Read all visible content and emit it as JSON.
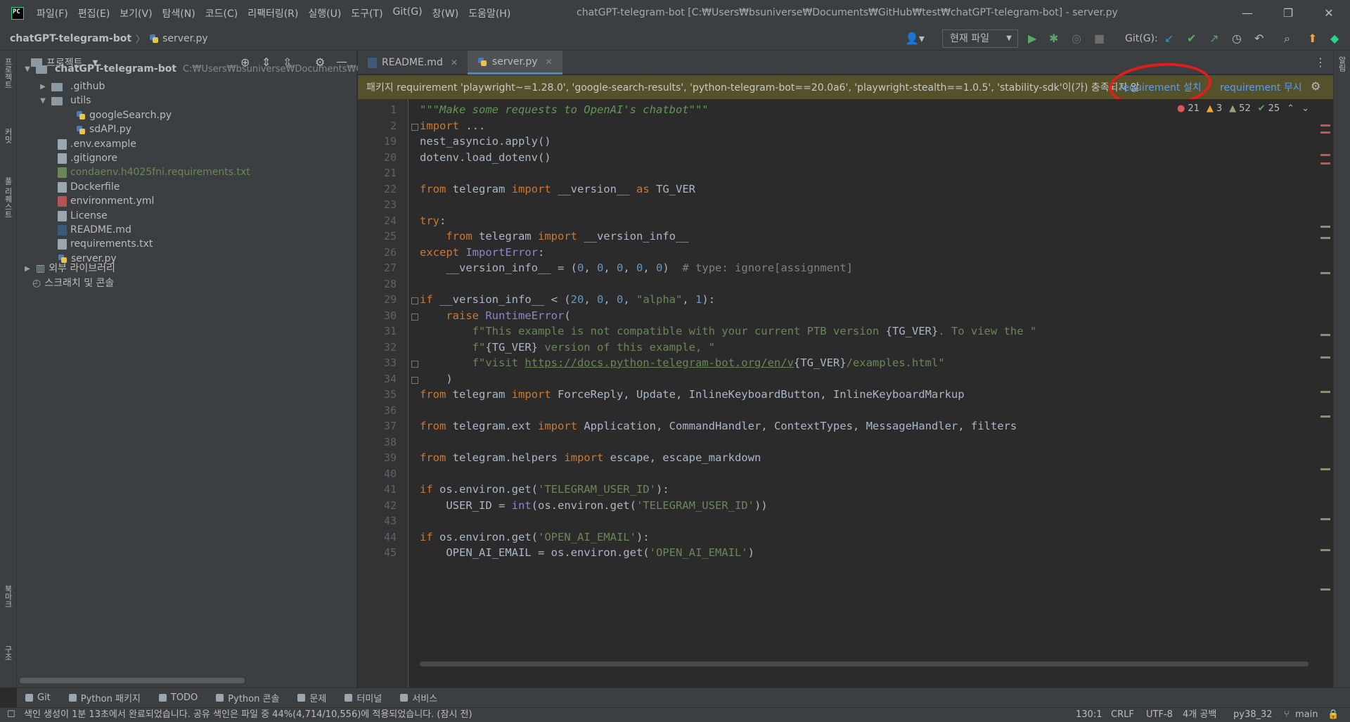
{
  "menu": [
    "파일(F)",
    "편집(E)",
    "보기(V)",
    "탐색(N)",
    "코드(C)",
    "리팩터링(R)",
    "실행(U)",
    "도구(T)",
    "Git(G)",
    "창(W)",
    "도움말(H)"
  ],
  "window_title": "chatGPT-telegram-bot [C:₩Users₩bsuniverse₩Documents₩GitHub₩test₩chatGPT-telegram-bot] - server.py",
  "breadcrumb": {
    "project": "chatGPT-telegram-bot",
    "file": "server.py"
  },
  "toolbar": {
    "run_config": "현재 파일",
    "git_label": "Git(G):"
  },
  "left_strip": [
    "프로젝트",
    "커밋",
    "풀 리퀘스트",
    "북마크",
    "구조"
  ],
  "right_strip": [
    "알림"
  ],
  "project_panel": {
    "title": "프로젝트",
    "root": {
      "name": "chatGPT-telegram-bot",
      "path": "C:₩Users₩bsuniverse₩Documents₩Git"
    },
    "items": [
      {
        "label": ".github",
        "kind": "folder",
        "expanded": false
      },
      {
        "label": "utils",
        "kind": "folder",
        "expanded": true
      },
      {
        "label": "googleSearch.py",
        "kind": "py"
      },
      {
        "label": "sdAPI.py",
        "kind": "py"
      },
      {
        "label": ".env.example",
        "kind": "file"
      },
      {
        "label": ".gitignore",
        "kind": "file"
      },
      {
        "label": "condaenv.h4025fni.requirements.txt",
        "kind": "file-green"
      },
      {
        "label": "Dockerfile",
        "kind": "file"
      },
      {
        "label": "environment.yml",
        "kind": "yml"
      },
      {
        "label": "License",
        "kind": "file"
      },
      {
        "label": "README.md",
        "kind": "md"
      },
      {
        "label": "requirements.txt",
        "kind": "file"
      },
      {
        "label": "server.py",
        "kind": "py"
      }
    ],
    "external_libs": "외부 라이브러리",
    "scratches": "스크래치 및 콘솔"
  },
  "tabs": [
    {
      "label": "README.md",
      "active": false
    },
    {
      "label": "server.py",
      "active": true
    }
  ],
  "banner": {
    "message": "패키지 requirement 'playwright~=1.28.0', 'google-search-results', 'python-telegram-bot==20.0a6', 'playwright-stealth==1.0.5', 'stability-sdk'이(가) 충족되지 않",
    "install": "requirement 설치",
    "ignore": "requirement 무시"
  },
  "inspections": {
    "errors": "21",
    "warnings": "3",
    "weak_warnings": "52",
    "typos": "25"
  },
  "code_lines": [
    {
      "n": "1",
      "html": "<span class=\"doc\">\"\"\"Make some requests to OpenAI's chatbot\"\"\"</span>"
    },
    {
      "n": "2",
      "html": "<span class=\"kw\">import</span> ..."
    },
    {
      "n": "19",
      "html": "nest_asyncio.apply()"
    },
    {
      "n": "20",
      "html": "dotenv.load_dotenv()"
    },
    {
      "n": "21",
      "html": ""
    },
    {
      "n": "22",
      "html": "<span class=\"kw\">from</span> telegram <span class=\"kw\">import</span> __version__ <span class=\"kw\">as</span> TG_VER"
    },
    {
      "n": "23",
      "html": ""
    },
    {
      "n": "24",
      "html": "<span class=\"kw\">try</span>:"
    },
    {
      "n": "25",
      "html": "    <span class=\"kw\">from</span> telegram <span class=\"kw\">import</span> __version_info__"
    },
    {
      "n": "26",
      "html": "<span class=\"kw\">except</span> <span class=\"bi\">ImportError</span>:"
    },
    {
      "n": "27",
      "html": "    __version_info__ = (<span class=\"num\">0</span>, <span class=\"num\">0</span>, <span class=\"num\">0</span>, <span class=\"num\">0</span>, <span class=\"num\">0</span>)  <span class=\"cmt\"># type: ignore[assignment]</span>"
    },
    {
      "n": "28",
      "html": ""
    },
    {
      "n": "29",
      "html": "<span class=\"kw\">if</span> __version_info__ &lt; (<span class=\"num\">20</span>, <span class=\"num\">0</span>, <span class=\"num\">0</span>, <span class=\"str\">\"alpha\"</span>, <span class=\"num\">1</span>):"
    },
    {
      "n": "30",
      "html": "    <span class=\"kw\">raise</span> <span class=\"bi\">RuntimeError</span>("
    },
    {
      "n": "31",
      "html": "        <span class=\"str\">f\"This example is not compatible with your current PTB version </span>{TG_VER}<span class=\"str\">. To view the \"</span>"
    },
    {
      "n": "32",
      "html": "        <span class=\"str\">f\"</span>{TG_VER}<span class=\"str\"> version of this example, \"</span>"
    },
    {
      "n": "33",
      "html": "        <span class=\"str\">f\"visit <u>https://docs.python-telegram-bot.org/en/v</u></span>{TG_VER}<span class=\"str\">/examples.html\"</span>"
    },
    {
      "n": "34",
      "html": "    )"
    },
    {
      "n": "35",
      "html": "<span class=\"kw\">from</span> telegram <span class=\"kw\">import</span> ForceReply, Update, InlineKeyboardButton, InlineKeyboardMarkup"
    },
    {
      "n": "36",
      "html": ""
    },
    {
      "n": "37",
      "html": "<span class=\"kw\">from</span> telegram.ext <span class=\"kw\">import</span> Application, CommandHandler, ContextTypes, MessageHandler, filters"
    },
    {
      "n": "38",
      "html": ""
    },
    {
      "n": "39",
      "html": "<span class=\"kw\">from</span> telegram.helpers <span class=\"kw\">import</span> escape, escape_markdown"
    },
    {
      "n": "40",
      "html": ""
    },
    {
      "n": "41",
      "html": "<span class=\"kw\">if</span> os.environ.get(<span class=\"str\">'TELEGRAM_USER_ID'</span>):"
    },
    {
      "n": "42",
      "html": "    USER_ID = <span class=\"bi\">int</span>(os.environ.get(<span class=\"str\">'TELEGRAM_USER_ID'</span>))"
    },
    {
      "n": "43",
      "html": ""
    },
    {
      "n": "44",
      "html": "<span class=\"kw\">if</span> os.environ.get(<span class=\"str\">'OPEN_AI_EMAIL'</span>):"
    },
    {
      "n": "45",
      "html": "    OPEN_AI_EMAIL = os.environ.get(<span class=\"str\">'OPEN_AI_EMAIL'</span>)"
    }
  ],
  "bottom_tabs": [
    "Git",
    "Python 패키지",
    "TODO",
    "Python 콘솔",
    "문제",
    "터미널",
    "서비스"
  ],
  "status": {
    "message": "색인 생성이 1분 13초에서 완료되었습니다. 공유 색인은 파일 중 44%(4,714/10,556)에 적용되었습니다. (잠시 전)",
    "position": "130:1",
    "line_sep": "CRLF",
    "encoding": "UTF-8",
    "indent": "4개 공백",
    "interpreter": "py38_32",
    "branch": "main"
  },
  "colors": {
    "annotation_circle": "#e11d1d",
    "banner_bg": "#54512b",
    "link": "#589df6"
  }
}
